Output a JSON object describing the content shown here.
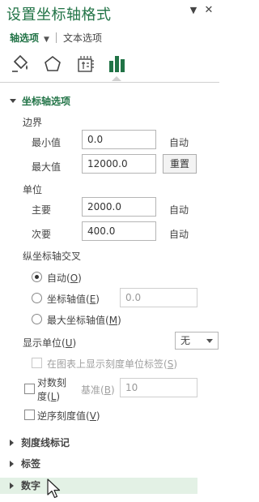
{
  "pane": {
    "title": "设置坐标轴格式",
    "chevron_icon": "chevron-down-icon",
    "close_icon": "close-icon"
  },
  "tabs": {
    "active": "轴选项",
    "inactive": "文本选项"
  },
  "icon_tabs": [
    "fill-line-icon",
    "effects-pentagon-icon",
    "size-properties-icon",
    "axis-options-bar-chart-icon"
  ],
  "accent_color": "#217346",
  "section": {
    "title": "坐标轴选项",
    "bounds": {
      "label": "边界",
      "min_label": "最小值",
      "min_value": "0.0",
      "min_status": "自动",
      "max_label": "最大值",
      "max_value": "12000.0",
      "max_button": "重置"
    },
    "units": {
      "label": "单位",
      "major_label": "主要",
      "major_value": "2000.0",
      "major_status": "自动",
      "minor_label": "次要",
      "minor_value": "400.0",
      "minor_status": "自动"
    },
    "crosses": {
      "label": "纵坐标轴交叉",
      "options": [
        {
          "label": "自动",
          "key": "O",
          "checked": true
        },
        {
          "label": "坐标轴值",
          "key": "E",
          "checked": false
        },
        {
          "label": "最大坐标轴值",
          "key": "M",
          "checked": false
        }
      ],
      "axis_value": "0.0"
    },
    "display_units": {
      "label": "显示单位",
      "key": "U",
      "selected": "无",
      "show_label": "在图表上显示刻度单位标签",
      "show_key": "S"
    },
    "log_scale": {
      "label_line1": "对数刻",
      "label_line2": "度",
      "key": "L",
      "base_label": "基准",
      "base_key": "B",
      "base_value": "10"
    },
    "reverse": {
      "label": "逆序刻度值",
      "key": "V"
    }
  },
  "collapsed_sections": [
    "刻度线标记",
    "标签",
    "数字"
  ]
}
